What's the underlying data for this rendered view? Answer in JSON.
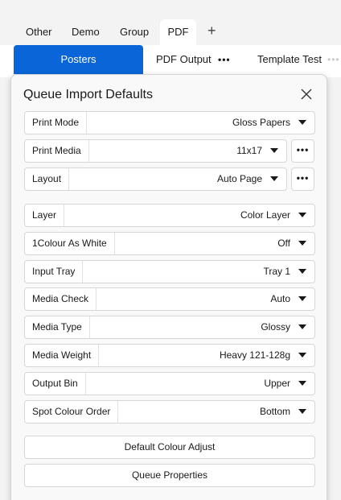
{
  "top_tabs": {
    "items": [
      "Other",
      "Demo",
      "Group",
      "PDF"
    ],
    "active": "PDF",
    "add_label": "+"
  },
  "sub_tabs": {
    "active_label": "Posters",
    "pdf_output": "PDF Output",
    "more_dots": "•••",
    "template_test": "Template Test",
    "faded_dots": "•••"
  },
  "dialog": {
    "title": "Queue Import Defaults",
    "close_glyph": "close-icon",
    "more_label": "•••",
    "rows_top": [
      {
        "label": "Print Mode",
        "value": "Gloss Papers"
      },
      {
        "label": "Print Media",
        "value": "11x17"
      },
      {
        "label": "Layout",
        "value": "Auto Page"
      }
    ],
    "rows": [
      {
        "label": "Layer",
        "value": "Color Layer"
      },
      {
        "label": "1Colour As White",
        "value": "Off"
      },
      {
        "label": "Input Tray",
        "value": "Tray 1"
      },
      {
        "label": "Media Check",
        "value": "Auto"
      },
      {
        "label": "Media Type",
        "value": "Glossy"
      },
      {
        "label": "Media Weight",
        "value": "Heavy 121-128g"
      },
      {
        "label": "Output Bin",
        "value": "Upper"
      },
      {
        "label": "Spot Colour Order",
        "value": "Bottom"
      }
    ],
    "buttons": {
      "colour_adjust": "Default Colour Adjust",
      "queue_properties": "Queue Properties"
    }
  },
  "colors": {
    "accent": "#0a66d8",
    "background": "#f3f3f3",
    "dialog_bg": "#f9f9f9"
  }
}
